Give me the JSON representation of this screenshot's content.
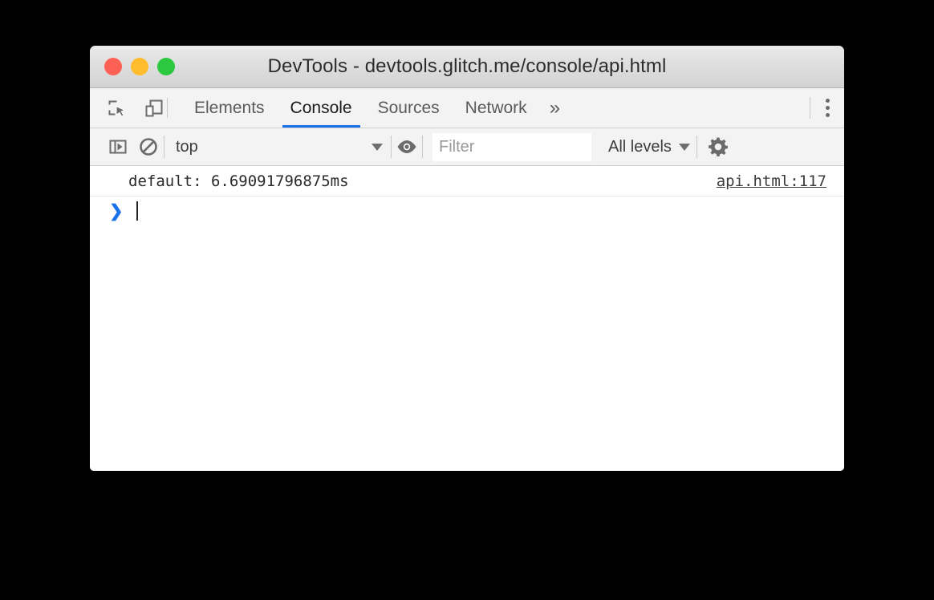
{
  "window": {
    "title": "DevTools - devtools.glitch.me/console/api.html",
    "traffic_lights": {
      "close_color": "#ff6054",
      "minimize_color": "#ffbd2e",
      "maximize_color": "#2bc840"
    }
  },
  "tabstrip": {
    "inspect_icon": "inspect-element-icon",
    "device_icon": "device-toolbar-icon",
    "tabs": [
      {
        "label": "Elements",
        "active": false
      },
      {
        "label": "Console",
        "active": true
      },
      {
        "label": "Sources",
        "active": false
      },
      {
        "label": "Network",
        "active": false
      }
    ],
    "more_tabs_label": "»",
    "menu_icon": "more-options-icon",
    "active_underline_color": "#1a73e8"
  },
  "console_toolbar": {
    "sidebar_toggle_icon": "console-sidebar-icon",
    "clear_icon": "clear-console-icon",
    "context": {
      "selected": "top",
      "options": [
        "top"
      ]
    },
    "live_expression_icon": "eye-icon",
    "filter": {
      "value": "",
      "placeholder": "Filter"
    },
    "levels": {
      "selected": "All levels",
      "options": [
        "All levels"
      ]
    },
    "settings_icon": "gear-icon"
  },
  "console": {
    "messages": [
      {
        "text": "default: 6.69091796875ms",
        "source": "api.html:117"
      }
    ],
    "prompt": {
      "chevron": "❯",
      "value": ""
    }
  }
}
